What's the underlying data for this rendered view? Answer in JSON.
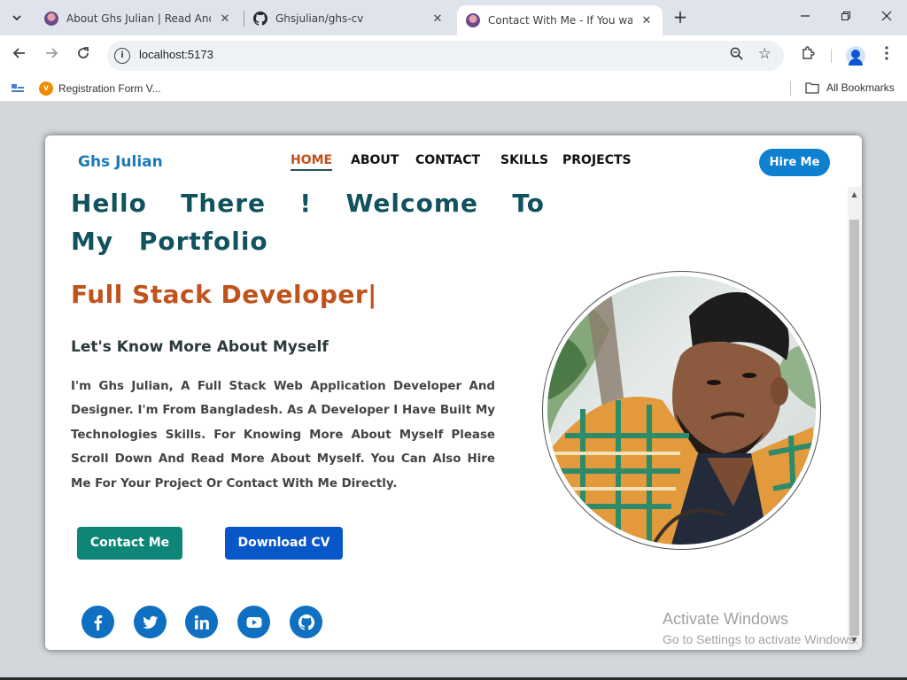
{
  "browser": {
    "tabs": [
      {
        "title": "About Ghs Julian | Read And Kn",
        "active": false
      },
      {
        "title": "Ghsjulian/ghs-cv",
        "active": false
      },
      {
        "title": "Contact With Me - If You want t",
        "active": true
      }
    ],
    "url": "localhost:5173",
    "bookmarks": [
      {
        "label": "Registration Form V..."
      }
    ],
    "all_bookmarks_label": "All Bookmarks"
  },
  "site": {
    "brand": "Ghs Julian",
    "nav": [
      {
        "label": "HOME",
        "active": true
      },
      {
        "label": "ABOUT",
        "active": false
      },
      {
        "label": "CONTACT",
        "active": false
      },
      {
        "label": "SKILLS",
        "active": false
      },
      {
        "label": "PROJECTS",
        "active": false
      }
    ],
    "hire_label": "Hire Me"
  },
  "hero": {
    "headline": "Hello There ! Welcome To My Portfolio",
    "role": "Full Stack Developer|",
    "subheading": "Let's Know More About Myself",
    "bio": "I'm Ghs Julian, A Full Stack Web Application Developer And Designer. I'm From Bangladesh. As A Developer I Have Built My Technologies Skills. For Knowing More About Myself Please Scroll Down And Read More About Myself. You Can Also Hire Me For Your Project Or Contact With Me Directly.",
    "contact_label": "Contact Me",
    "cv_label": "Download CV",
    "social": [
      "facebook-icon",
      "twitter-icon",
      "linkedin-icon",
      "youtube-icon",
      "github-icon"
    ]
  },
  "os": {
    "watermark_title": "Activate Windows",
    "watermark_sub": "Go to Settings to activate Windows."
  },
  "colors": {
    "brand": "#1a7ab8",
    "headline": "#10525e",
    "role": "#c0521c",
    "hire": "#0f7fd0",
    "contact": "#0d8577",
    "cv": "#0857c8",
    "social": "#0f6fc0"
  }
}
